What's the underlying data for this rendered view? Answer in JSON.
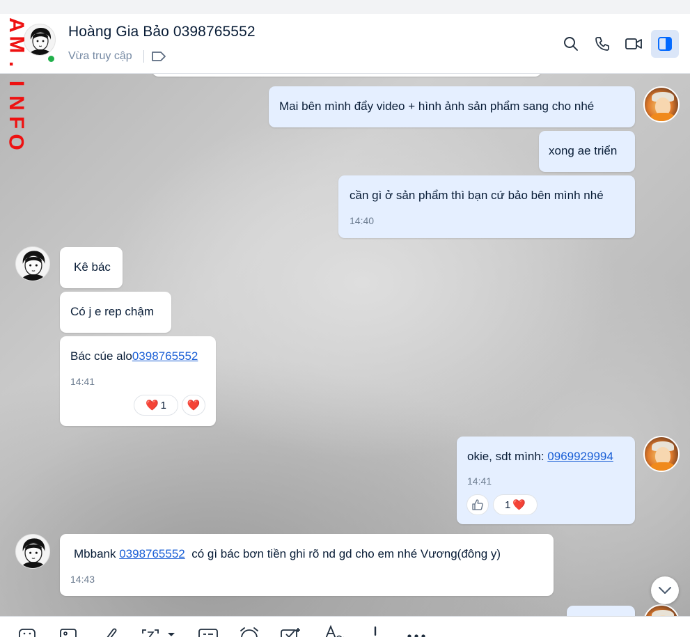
{
  "watermark": "AM.INFO",
  "header": {
    "contact_name": "Hoàng Gia Bảo 0398765552",
    "status": "Vừa truy cập"
  },
  "icons": {
    "search": "search-icon",
    "call": "phone-icon",
    "video": "video-camera-icon",
    "panel": "sidebar-panel-icon",
    "tag": "tag-label-icon"
  },
  "colors": {
    "sent_bubble": "#e5efff",
    "received_bubble": "#ffffff",
    "link": "#1a5fd6",
    "online": "#21b04b",
    "accent": "#0068ff"
  },
  "messages": [
    {
      "id": "m1",
      "side": "sent",
      "text": "Mai bên mình đẩy video + hình ảnh sản phẩm sang cho nhé"
    },
    {
      "id": "m2",
      "side": "sent",
      "text": "xong ae triển"
    },
    {
      "id": "m3",
      "side": "sent",
      "text": "cần gì ở sản phẩm thì bạn cứ bảo bên mình nhé",
      "time": "14:40"
    },
    {
      "id": "m4",
      "side": "received",
      "text": "Kê bác"
    },
    {
      "id": "m5",
      "side": "received",
      "text": "Có j e rep chậm"
    },
    {
      "id": "m6",
      "side": "received",
      "text": "Bác cúe alo",
      "link": "0398765552",
      "time": "14:41",
      "reactions": [
        {
          "emoji": "❤️",
          "count": "1"
        },
        {
          "emoji": "❤️",
          "count": ""
        }
      ]
    },
    {
      "id": "m7",
      "side": "sent",
      "text": "okie, sdt mình: ",
      "link": "0969929994",
      "time": "14:41",
      "reactions": [
        {
          "emoji": "like",
          "count": ""
        },
        {
          "emoji": "❤️",
          "count": "1"
        }
      ]
    },
    {
      "id": "m8",
      "side": "received",
      "text_before": "Mbbank ",
      "link": "0398765552",
      "text_after": "  có gì bác bơn tiền ghi rõ nd gd cho em nhé Vương(đông y)",
      "time": "14:43"
    }
  ],
  "toolbar": {
    "items": [
      "sticker-icon",
      "image-icon",
      "attachment-icon",
      "screenshot-icon",
      "contact-card-icon",
      "reminder-clock-icon",
      "task-checklist-icon",
      "text-format-icon",
      "urgent-icon",
      "more-icon"
    ]
  }
}
